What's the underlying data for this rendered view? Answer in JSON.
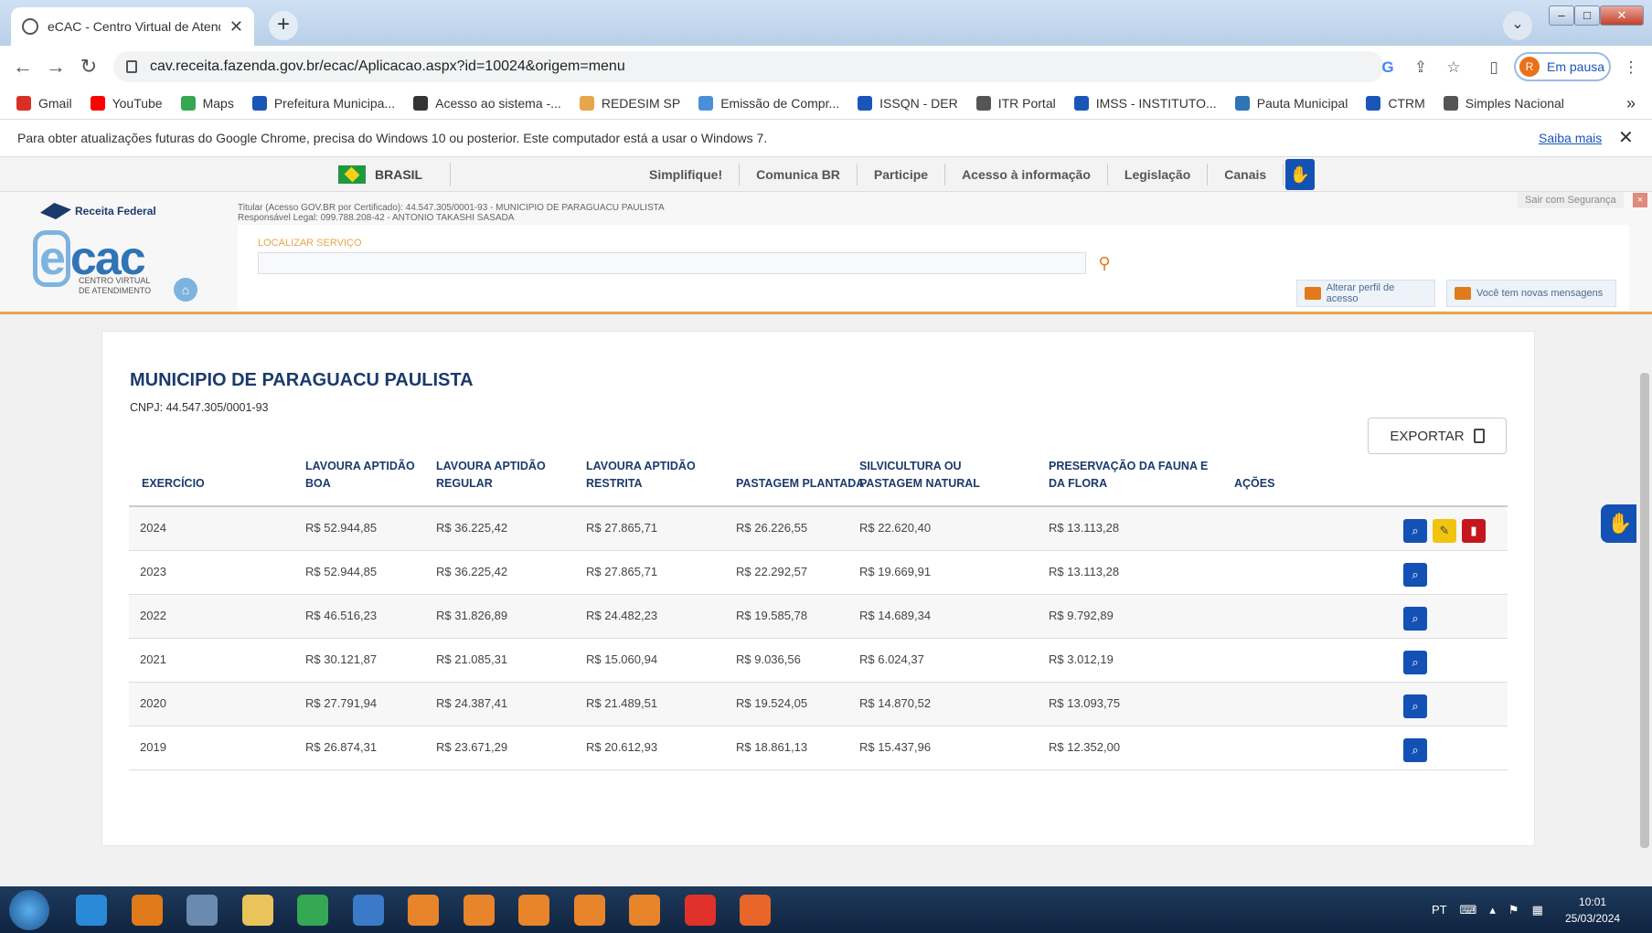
{
  "browser": {
    "tab_title": "eCAC - Centro Virtual de Atendim",
    "url": "cav.receita.fazenda.gov.br/ecac/Aplicacao.aspx?id=10024&origem=menu",
    "profile_initial": "R",
    "profile_label": "Em pausa"
  },
  "bookmarks": [
    {
      "label": "Gmail",
      "color": "#d93025"
    },
    {
      "label": "YouTube",
      "color": "#ff0000"
    },
    {
      "label": "Maps",
      "color": "#34a853"
    },
    {
      "label": "Prefeitura Municipa...",
      "color": "#1a56b8"
    },
    {
      "label": "Acesso ao sistema -...",
      "color": "#333333"
    },
    {
      "label": "REDESIM SP",
      "color": "#e8a64a"
    },
    {
      "label": "Emissão de Compr...",
      "color": "#4a90d9"
    },
    {
      "label": "ISSQN - DER",
      "color": "#1a56b8"
    },
    {
      "label": "ITR Portal",
      "color": "#555555"
    },
    {
      "label": "IMSS - INSTITUTO...",
      "color": "#1a56b8"
    },
    {
      "label": "Pauta Municipal",
      "color": "#2f74b5"
    },
    {
      "label": "CTRM",
      "color": "#1a56b8"
    },
    {
      "label": "Simples Nacional",
      "color": "#555555"
    }
  ],
  "infobar": {
    "message": "Para obter atualizações futuras do Google Chrome, precisa do Windows 10 ou posterior. Este computador está a usar o Windows 7.",
    "link": "Saiba mais"
  },
  "govbar": {
    "brasil": "BRASIL",
    "links": [
      "Simplifique!",
      "Comunica BR",
      "Participe",
      "Acesso à informação",
      "Legislação",
      "Canais"
    ]
  },
  "ecac": {
    "rf_label": "Receita Federal",
    "logo_text": "cac",
    "logo_sub1": "CENTRO VIRTUAL",
    "logo_sub2": "DE ATENDIMENTO",
    "titular": "Titular (Acesso GOV.BR por Certificado): 44.547.305/0001-93 - MUNICIPIO DE PARAGUACU PAULISTA",
    "responsavel": "Responsável Legal: 099.788.208-42 - ANTONIO TAKASHI SASADA",
    "sair": "Sair com Segurança",
    "search_label": "LOCALIZAR SERVIÇO",
    "btn_perfil": "Alterar perfil de acesso",
    "btn_msgs": "Você tem novas mensagens"
  },
  "main": {
    "company": "MUNICIPIO DE PARAGUACU PAULISTA",
    "cnpj": "CNPJ: 44.547.305/0001-93",
    "export": "EXPORTAR",
    "headers": [
      "EXERCÍCIO",
      "LAVOURA APTIDÃO BOA",
      "LAVOURA APTIDÃO REGULAR",
      "LAVOURA APTIDÃO RESTRITA",
      "PASTAGEM PLANTADA",
      "SILVICULTURA OU PASTAGEM NATURAL",
      "PRESERVAÇÃO DA FAUNA E DA FLORA",
      "AÇÕES"
    ],
    "rows": [
      {
        "ano": "2024",
        "boa": "R$ 52.944,85",
        "regular": "R$ 36.225,42",
        "restrita": "R$ 27.865,71",
        "pastagem": "R$ 26.226,55",
        "silvicultura": "R$ 22.620,40",
        "preservacao": "R$ 13.113,28",
        "actions": [
          "view",
          "edit",
          "delete"
        ]
      },
      {
        "ano": "2023",
        "boa": "R$ 52.944,85",
        "regular": "R$ 36.225,42",
        "restrita": "R$ 27.865,71",
        "pastagem": "R$ 22.292,57",
        "silvicultura": "R$ 19.669,91",
        "preservacao": "R$ 13.113,28",
        "actions": [
          "view"
        ]
      },
      {
        "ano": "2022",
        "boa": "R$ 46.516,23",
        "regular": "R$ 31.826,89",
        "restrita": "R$ 24.482,23",
        "pastagem": "R$ 19.585,78",
        "silvicultura": "R$ 14.689,34",
        "preservacao": "R$ 9.792,89",
        "actions": [
          "view"
        ]
      },
      {
        "ano": "2021",
        "boa": "R$ 30.121,87",
        "regular": "R$ 21.085,31",
        "restrita": "R$ 15.060,94",
        "pastagem": "R$ 9.036,56",
        "silvicultura": "R$ 6.024,37",
        "preservacao": "R$ 3.012,19",
        "actions": [
          "view"
        ]
      },
      {
        "ano": "2020",
        "boa": "R$ 27.791,94",
        "regular": "R$ 24.387,41",
        "restrita": "R$ 21.489,51",
        "pastagem": "R$ 19.524,05",
        "silvicultura": "R$ 14.870,52",
        "preservacao": "R$ 13.093,75",
        "actions": [
          "view"
        ]
      },
      {
        "ano": "2019",
        "boa": "R$ 26.874,31",
        "regular": "R$ 23.671,29",
        "restrita": "R$ 20.612,93",
        "pastagem": "R$ 18.861,13",
        "silvicultura": "R$ 15.437,96",
        "preservacao": "R$ 12.352,00",
        "actions": [
          "view"
        ]
      }
    ]
  },
  "taskbar": {
    "apps": [
      {
        "name": "internet-explorer",
        "color": "#2a8ad8"
      },
      {
        "name": "media-player",
        "color": "#e07a1a"
      },
      {
        "name": "app-generic",
        "color": "#6a8ab0"
      },
      {
        "name": "file-explorer",
        "color": "#e8c45a"
      },
      {
        "name": "chrome",
        "color": "#34a853"
      },
      {
        "name": "network",
        "color": "#3a7ac8"
      },
      {
        "name": "app-orange-1",
        "color": "#e8842a"
      },
      {
        "name": "app-orange-2",
        "color": "#e8842a"
      },
      {
        "name": "app-orange-3",
        "color": "#e8842a"
      },
      {
        "name": "app-orange-4",
        "color": "#e8842a"
      },
      {
        "name": "app-orange-5",
        "color": "#e8842a"
      },
      {
        "name": "anydesk",
        "color": "#e0322a"
      },
      {
        "name": "firefox",
        "color": "#e8662a"
      }
    ],
    "lang": "PT",
    "time": "10:01",
    "date": "25/03/2024"
  }
}
